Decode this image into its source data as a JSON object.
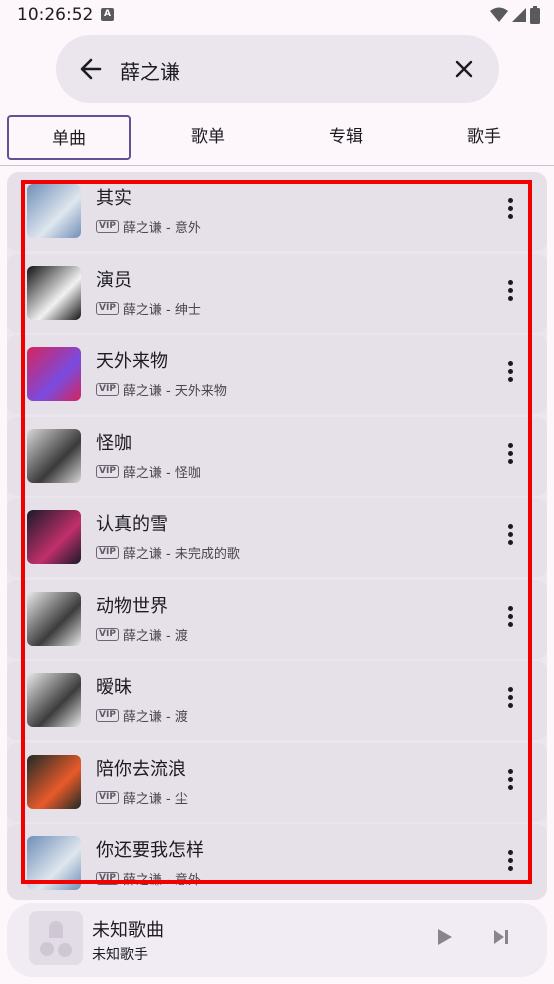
{
  "status_bar": {
    "time": "10:26:52",
    "notification_letter": "A"
  },
  "search": {
    "query": "薛之谦"
  },
  "tabs": [
    {
      "label": "单曲",
      "active": true
    },
    {
      "label": "歌单",
      "active": false
    },
    {
      "label": "专辑",
      "active": false
    },
    {
      "label": "歌手",
      "active": false
    }
  ],
  "badge": "VIP",
  "songs": [
    {
      "title": "其实",
      "subtitle": "薛之谦 - 意外",
      "cover_colors": [
        "#6f8fb8",
        "#dfe6ee"
      ]
    },
    {
      "title": "演员",
      "subtitle": "薛之谦 - 绅士",
      "cover_colors": [
        "#111111",
        "#f2f2f2"
      ]
    },
    {
      "title": "天外来物",
      "subtitle": "薛之谦 - 天外来物",
      "cover_colors": [
        "#d6245a",
        "#7a4be0"
      ]
    },
    {
      "title": "怪咖",
      "subtitle": "薛之谦 - 怪咖",
      "cover_colors": [
        "#d8d8d8",
        "#3a3a3a"
      ]
    },
    {
      "title": "认真的雪",
      "subtitle": "薛之谦 - 未完成的歌",
      "cover_colors": [
        "#1a1a2a",
        "#c02f6a"
      ]
    },
    {
      "title": "动物世界",
      "subtitle": "薛之谦 - 渡",
      "cover_colors": [
        "#e9e9e9",
        "#3c3c3c"
      ]
    },
    {
      "title": "暧昧",
      "subtitle": "薛之谦 - 渡",
      "cover_colors": [
        "#e9e9e9",
        "#3c3c3c"
      ]
    },
    {
      "title": "陪你去流浪",
      "subtitle": "薛之谦 - 尘",
      "cover_colors": [
        "#1e2a28",
        "#e85a2a"
      ]
    },
    {
      "title": "你还要我怎样",
      "subtitle": "薛之谦 - 意外",
      "cover_colors": [
        "#6f8fb8",
        "#dfe6ee"
      ]
    }
  ],
  "mini_player": {
    "title": "未知歌曲",
    "artist": "未知歌手"
  },
  "colors": {
    "accent": "#5e5495",
    "highlight": "#f20000",
    "surface": "#e6e0e9"
  }
}
